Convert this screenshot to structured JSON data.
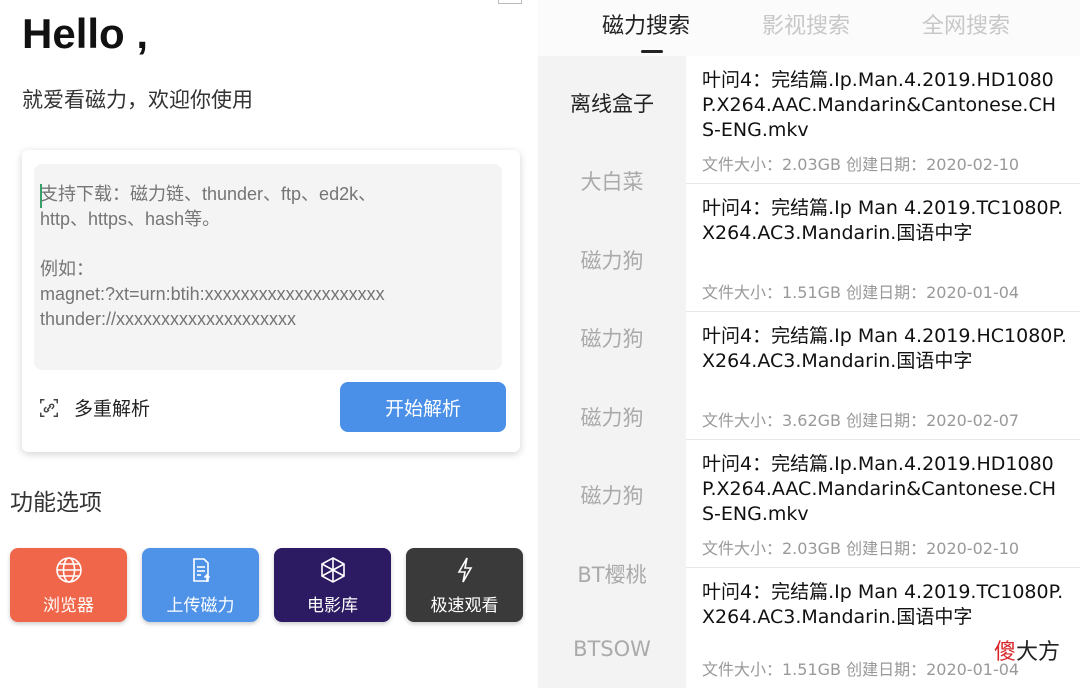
{
  "left": {
    "greeting": "Hello ,",
    "subtitle": "就爱看磁力，欢迎你使用",
    "input_placeholder": "支持下载：磁力链、thunder、ftp、ed2k、\nhttp、https、hash等。\n\n例如：\nmagnet:?xt=urn:btih:xxxxxxxxxxxxxxxxxxxx\nthunder://xxxxxxxxxxxxxxxxxxxx",
    "multi_parse_label": "多重解析",
    "start_button": "开始解析",
    "functions_title": "功能选项",
    "functions": [
      {
        "label": "浏览器",
        "icon": "globe-icon",
        "color": "#f0664a"
      },
      {
        "label": "上传磁力",
        "icon": "upload-file-icon",
        "color": "#4f93e8"
      },
      {
        "label": "电影库",
        "icon": "cube-icon",
        "color": "#2c1a63"
      },
      {
        "label": "极速观看",
        "icon": "lightning-icon",
        "color": "#3a3a3a"
      }
    ]
  },
  "right": {
    "tabs": [
      {
        "label": "磁力搜索",
        "active": true
      },
      {
        "label": "影视搜索",
        "active": false
      },
      {
        "label": "全网搜索",
        "active": false
      }
    ],
    "sources": [
      "离线盒子",
      "大白菜",
      "磁力狗",
      "磁力狗",
      "磁力狗",
      "磁力狗",
      "BT樱桃",
      "BTSOW"
    ],
    "results": [
      {
        "title": "叶问4：完结篇.Ip.Man.4.2019.HD1080P.X264.AAC.Mandarin&Cantonese.CHS-ENG.mkv",
        "meta": "文件大小：2.03GB 创建日期：2020-02-10"
      },
      {
        "title": "叶问4：完结篇.Ip Man 4.2019.TC1080P.X264.AC3.Mandarin.国语中字",
        "meta": "文件大小：1.51GB 创建日期：2020-01-04"
      },
      {
        "title": "叶问4：完结篇.Ip Man 4.2019.HC1080P.X264.AC3.Mandarin.国语中字",
        "meta": "文件大小：3.62GB 创建日期：2020-02-07"
      },
      {
        "title": "叶问4：完结篇.Ip.Man.4.2019.HD1080P.X264.AAC.Mandarin&Cantonese.CHS-ENG.mkv",
        "meta": "文件大小：2.03GB 创建日期：2020-02-10"
      },
      {
        "title": "叶问4：完结篇.Ip Man 4.2019.TC1080P.X264.AC3.Mandarin.国语中字",
        "meta": "文件大小：1.51GB 创建日期：2020-01-04"
      }
    ],
    "watermark_red": "傻",
    "watermark_black": "大方",
    "watermark_colors": {
      "red": "#d8262a",
      "black": "#222222"
    }
  }
}
